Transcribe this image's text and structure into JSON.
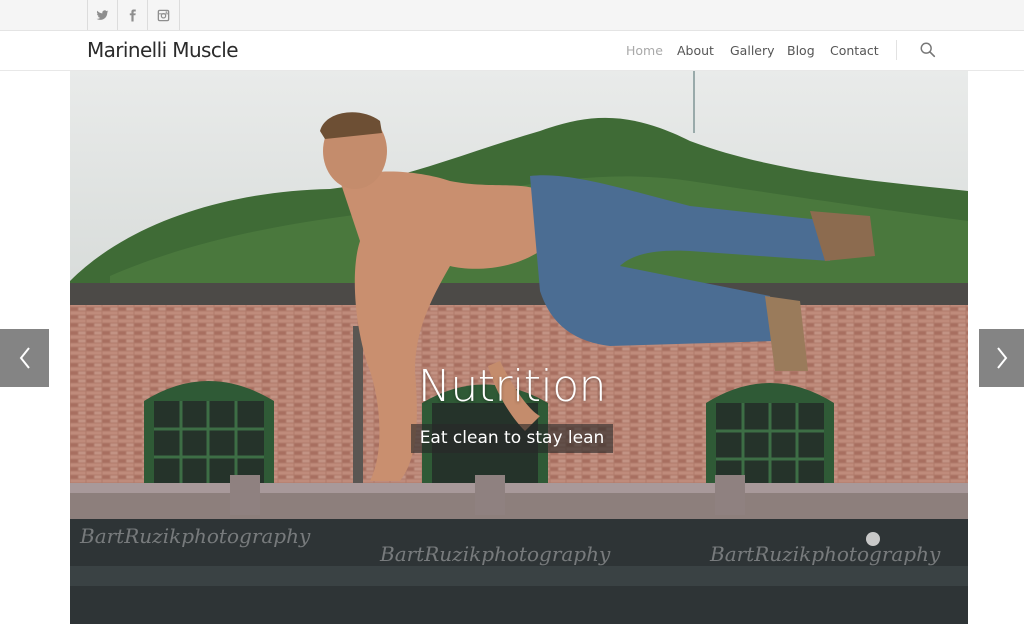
{
  "social": [
    {
      "icon": "twitter-icon"
    },
    {
      "icon": "facebook-icon"
    },
    {
      "icon": "instagram-icon"
    }
  ],
  "header": {
    "logo": "Marinelli Muscle",
    "nav": [
      {
        "label": "Home",
        "active": true
      },
      {
        "label": "About",
        "active": false
      },
      {
        "label": "Gallery",
        "active": false
      },
      {
        "label": "Blog",
        "active": false
      },
      {
        "label": "Contact",
        "active": false
      }
    ],
    "search_icon": "search-icon"
  },
  "slider": {
    "title": "Nutrition",
    "caption": "Eat clean to stay lean",
    "watermark": "BartRuzikphotography",
    "prev_icon": "chevron-left-icon",
    "next_icon": "chevron-right-icon"
  },
  "colors": {
    "nav_active": "#a9a9a9",
    "nav_text": "#555555",
    "logo": "#2b2b2b",
    "topbar_bg": "#f5f5f5"
  }
}
